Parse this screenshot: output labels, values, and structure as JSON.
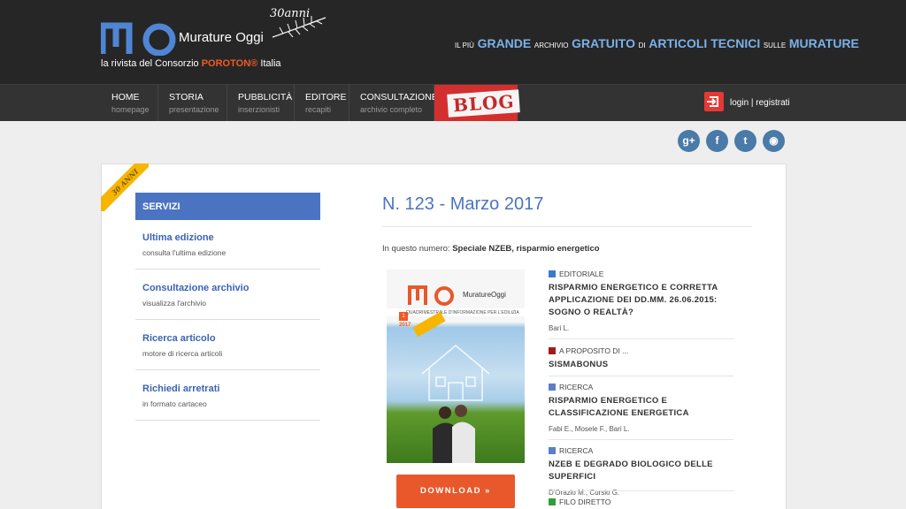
{
  "header": {
    "brand": "Murature Oggi",
    "anni": "30anni",
    "subtitle_pre": "la rivista del Consorzio",
    "subtitle_accent": "POROTON®",
    "subtitle_post": "Italia",
    "tagline": {
      "p1": "IL PIÙ",
      "p2": "GRANDE",
      "p3": "ARCHIVIO",
      "p4": "GRATUITO",
      "p5": "DI",
      "p6": "ARTICOLI TECNICI",
      "p7": "SULLE",
      "p8": "MURATURE"
    },
    "colors": {
      "accent_blue": "#7ab1e8",
      "accent_orange": "#f15a24"
    }
  },
  "nav": {
    "items": [
      {
        "label": "HOME",
        "sub": "homepage"
      },
      {
        "label": "STORIA",
        "sub": "presentazione"
      },
      {
        "label": "PUBBLICITÀ",
        "sub": "inserzionisti"
      },
      {
        "label": "EDITORE",
        "sub": "recapiti"
      },
      {
        "label": "CONSULTAZIONE",
        "sub": "archivio completo"
      }
    ],
    "blog": "BLOG",
    "login": "login | registrati"
  },
  "social": [
    {
      "icon": "google-plus-icon",
      "glyph": "g+"
    },
    {
      "icon": "facebook-icon",
      "glyph": "f"
    },
    {
      "icon": "twitter-icon",
      "glyph": "t"
    },
    {
      "icon": "rss-icon",
      "glyph": "◉"
    }
  ],
  "ribbon": "30 ANNI",
  "sidebar": {
    "title": "SERVIZI",
    "items": [
      {
        "label": "Ultima edizione",
        "desc": "consulta l'ultima edizione"
      },
      {
        "label": "Consultazione archivio",
        "desc": "visualizza l'archivio"
      },
      {
        "label": "Ricerca articolo",
        "desc": "motore di ricerca articoli"
      },
      {
        "label": "Richiedi arretrati",
        "desc": "in formato cartaceo"
      }
    ]
  },
  "issue": {
    "title": "N. 123 - Marzo 2017",
    "in_label": "In questo numero:",
    "in_value": "Speciale NZEB, risparmio energetico",
    "cover": {
      "brand": "MuratureOggi",
      "band": "QUADRIMESTRALE D'INFORMAZIONE PER L'EDILIZIA",
      "num": "1",
      "year": "2017"
    },
    "download": "DOWNLOAD »"
  },
  "articles": [
    {
      "cat": "EDITORIALE",
      "color": "#3a7bc8",
      "title": "RISPARMIO ENERGETICO E CORRETTA APPLICAZIONE DEI DD.MM. 26.06.2015: SOGNO O REALTÀ?",
      "auth": "Bari L."
    },
    {
      "cat": "A PROPOSITO DI ...",
      "color": "#a31a1a",
      "title": "SISMABONUS",
      "auth": ""
    },
    {
      "cat": "RICERCA",
      "color": "#5b7ec9",
      "title": "RISPARMIO ENERGETICO E CLASSIFICAZIONE ENERGETICA",
      "auth": "Fabi E., Mosele F., Bari L."
    },
    {
      "cat": "RICERCA",
      "color": "#5b7ec9",
      "title": "NZEB E DEGRADO BIOLOGICO DELLE SUPERFICI",
      "auth": "D'Orazio M., Cursio G."
    },
    {
      "cat": "FILO DIRETTO",
      "color": "#2e9e3a",
      "title": "",
      "auth": ""
    }
  ]
}
